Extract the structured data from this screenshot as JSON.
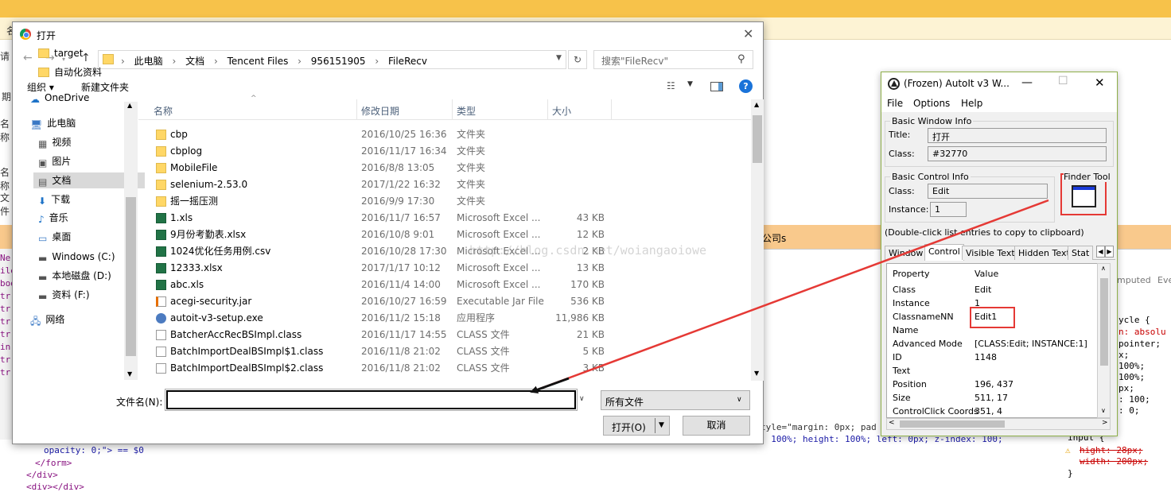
{
  "background": {
    "strip_chars": [
      "名",
      "请",
      "期",
      "名称",
      "名称",
      "文件"
    ],
    "orange_text": "公司s",
    "dev_left": [
      "Ne",
      "ile",
      "bod",
      "tr",
      "tr",
      "tr",
      "tr",
      "in",
      "tr",
      "tr"
    ],
    "code_line1": "tyle=\"margin: 0px; pad",
    "code_line2": ": 100%; height: 100%; left: 0px; z-index: 100;",
    "bottom_lines": [
      "opacity: 0;\"> == $0",
      "</form>",
      "</div>",
      "<div></div>"
    ],
    "styles_tabs": [
      "mputed",
      "Eve"
    ],
    "styles_lines": [
      "ycle {",
      "n: absolu",
      " pointer;",
      "x;",
      " 100%;",
      " 100%;",
      "px;",
      ": 100;",
      ": 0;"
    ],
    "styles2_lines": [
      "input {",
      "hight: 28px;",
      "width: 200px;",
      "}"
    ]
  },
  "dialog": {
    "title": "打开",
    "breadcrumbs": [
      "此电脑",
      "文档",
      "Tencent Files",
      "956151905",
      "FileRecv"
    ],
    "search_placeholder": "搜索\"FileRecv\"",
    "organize": "组织 ▾",
    "new_folder": "新建文件夹",
    "nav": [
      {
        "label": "target",
        "type": "folder"
      },
      {
        "label": "自动化资料",
        "type": "folder"
      },
      {
        "label": "OneDrive",
        "type": "cloud"
      },
      {
        "label": "此电脑",
        "type": "pc"
      },
      {
        "label": "视频",
        "type": "video"
      },
      {
        "label": "图片",
        "type": "image"
      },
      {
        "label": "文档",
        "type": "doc"
      },
      {
        "label": "下载",
        "type": "download"
      },
      {
        "label": "音乐",
        "type": "music"
      },
      {
        "label": "桌面",
        "type": "desktop"
      },
      {
        "label": "Windows (C:)",
        "type": "drive"
      },
      {
        "label": "本地磁盘 (D:)",
        "type": "drive"
      },
      {
        "label": "资料 (F:)",
        "type": "drive"
      },
      {
        "label": "网络",
        "type": "network"
      }
    ],
    "columns": [
      "名称",
      "修改日期",
      "类型",
      "大小"
    ],
    "files": [
      {
        "name": "cbp",
        "date": "2016/10/25 16:36",
        "type": "文件夹",
        "size": "",
        "icon": "folder"
      },
      {
        "name": "cbplog",
        "date": "2016/11/17 16:34",
        "type": "文件夹",
        "size": "",
        "icon": "folder"
      },
      {
        "name": "MobileFile",
        "date": "2016/8/8 13:05",
        "type": "文件夹",
        "size": "",
        "icon": "folder"
      },
      {
        "name": "selenium-2.53.0",
        "date": "2017/1/22 16:32",
        "type": "文件夹",
        "size": "",
        "icon": "folder"
      },
      {
        "name": "摇一摇压测",
        "date": "2016/9/9 17:30",
        "type": "文件夹",
        "size": "",
        "icon": "folder"
      },
      {
        "name": "1.xls",
        "date": "2016/11/7 16:57",
        "type": "Microsoft Excel ...",
        "size": "43 KB",
        "icon": "xls"
      },
      {
        "name": "9月份考勤表.xlsx",
        "date": "2016/10/8 9:01",
        "type": "Microsoft Excel ...",
        "size": "12 KB",
        "icon": "xls"
      },
      {
        "name": "1024优化任务用例.csv",
        "date": "2016/10/28 17:30",
        "type": "Microsoft Excel ...",
        "size": "2 KB",
        "icon": "xls"
      },
      {
        "name": "12333.xlsx",
        "date": "2017/1/17 10:12",
        "type": "Microsoft Excel ...",
        "size": "13 KB",
        "icon": "xls"
      },
      {
        "name": "abc.xls",
        "date": "2016/11/4 14:00",
        "type": "Microsoft Excel ...",
        "size": "170 KB",
        "icon": "xls"
      },
      {
        "name": "acegi-security.jar",
        "date": "2016/10/27 16:59",
        "type": "Executable Jar File",
        "size": "536 KB",
        "icon": "jar"
      },
      {
        "name": "autoit-v3-setup.exe",
        "date": "2016/11/2 15:18",
        "type": "应用程序",
        "size": "11,986 KB",
        "icon": "exe"
      },
      {
        "name": "BatcherAccRecBSImpl.class",
        "date": "2016/11/17 14:55",
        "type": "CLASS 文件",
        "size": "21 KB",
        "icon": "doc"
      },
      {
        "name": "BatchImportDealBSImpl$1.class",
        "date": "2016/11/8 21:02",
        "type": "CLASS 文件",
        "size": "5 KB",
        "icon": "doc"
      },
      {
        "name": "BatchImportDealBSImpl$2.class",
        "date": "2016/11/8 21:02",
        "type": "CLASS 文件",
        "size": "3 KB",
        "icon": "doc"
      }
    ],
    "filename_label": "文件名(N):",
    "filename_value": "",
    "filetype": "所有文件",
    "open_label": "打开(O)",
    "cancel_label": "取消"
  },
  "autoit": {
    "title": "(Frozen) AutoIt v3 W...",
    "menu": [
      "File",
      "Options",
      "Help"
    ],
    "basic_window_info": "Basic Window Info",
    "title_label": "Title:",
    "title_value": "打开",
    "class_label": "Class:",
    "class_value": "#32770",
    "basic_control_info": "Basic Control Info",
    "ctrl_class_label": "Class:",
    "ctrl_class_value": "Edit",
    "instance_label": "Instance:",
    "instance_value": "1",
    "finder_tool": "Finder Tool",
    "dblclick_hint": "(Double-click list entries to copy to clipboard)",
    "tabs": [
      "Window",
      "Control",
      "Visible Text",
      "Hidden Text",
      "Stat"
    ],
    "selected_tab": "Control",
    "list_header": [
      "Property",
      "Value"
    ],
    "properties": [
      {
        "p": "Class",
        "v": "Edit"
      },
      {
        "p": "Instance",
        "v": "1"
      },
      {
        "p": "ClassnameNN",
        "v": "Edit1"
      },
      {
        "p": "Name",
        "v": ""
      },
      {
        "p": "Advanced Mode",
        "v": "[CLASS:Edit; INSTANCE:1]"
      },
      {
        "p": "ID",
        "v": "1148"
      },
      {
        "p": "Text",
        "v": ""
      },
      {
        "p": "Position",
        "v": "196, 437"
      },
      {
        "p": "Size",
        "v": "511, 17"
      },
      {
        "p": "ControlClick Coords",
        "v": "351, 4"
      }
    ]
  },
  "watermark": "http://blog.csdn.net/woiangaoiowe",
  "colors": {
    "highlight": "#e53935",
    "accent": "#1a73d9"
  }
}
